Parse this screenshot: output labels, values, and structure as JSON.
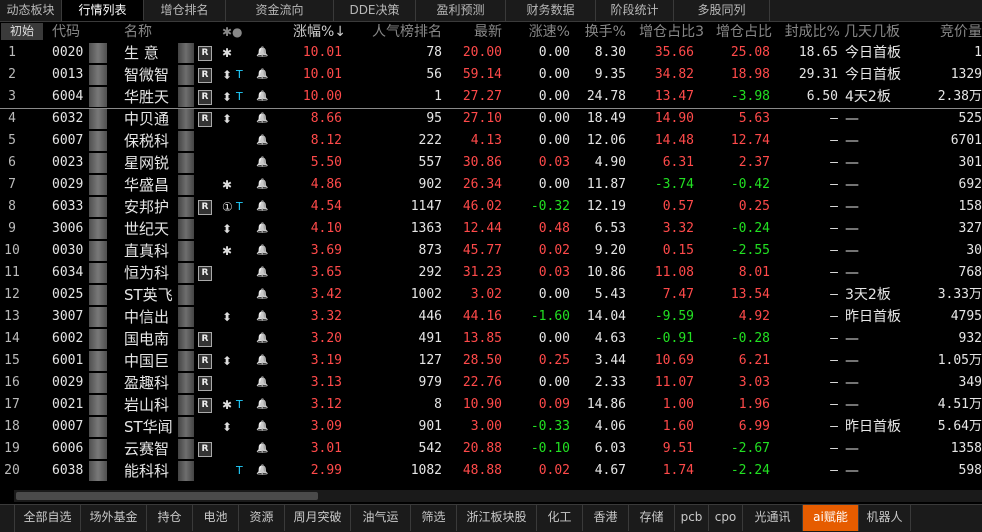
{
  "top_tabs": [
    "动态板块",
    "行情列表",
    "增仓排名",
    "资金流向",
    "DDE决策",
    "盈利预测",
    "财务数据",
    "阶段统计",
    "多股同列"
  ],
  "active_top_tab": 1,
  "header": {
    "init_label": "初始",
    "code": "代码",
    "name": "名称",
    "flags": "✱●",
    "change_pct": "涨幅%↓",
    "popularity": "人气榜排名",
    "latest": "最新",
    "speed": "涨速%",
    "turnover": "换手%",
    "add_pos1": "增仓占比3",
    "add_pos2": "增仓占比",
    "seal_ratio": "封成比%",
    "board_days": "几天几板",
    "auction": "竞价量"
  },
  "rows": [
    {
      "idx": "1",
      "code": "0020",
      "name": "生 意 ",
      "r": true,
      "f1": "✱",
      "t": false,
      "chg": "10.01",
      "chg_c": "red",
      "pop": "78",
      "last": "20.00",
      "last_c": "red",
      "spd": "0.00",
      "spd_c": "white",
      "turn": "8.30",
      "a1": "35.66",
      "a1_c": "red",
      "a2": "25.08",
      "a2_c": "red",
      "seal": "18.65",
      "board": "今日首板",
      "auc": "1"
    },
    {
      "idx": "2",
      "code": "0013",
      "name": "智微智",
      "r": true,
      "f1": "⬍",
      "t": true,
      "chg": "10.01",
      "chg_c": "red",
      "pop": "56",
      "last": "59.14",
      "last_c": "red",
      "spd": "0.00",
      "spd_c": "white",
      "turn": "9.35",
      "a1": "34.82",
      "a1_c": "red",
      "a2": "18.98",
      "a2_c": "red",
      "seal": "29.31",
      "board": "今日首板",
      "auc": "1329"
    },
    {
      "idx": "3",
      "code": "6004",
      "name": "华胜天",
      "r": true,
      "f1": "⬍",
      "t": true,
      "chg": "10.00",
      "chg_c": "red",
      "pop": "1",
      "last": "27.27",
      "last_c": "red",
      "spd": "0.00",
      "spd_c": "white",
      "turn": "24.78",
      "a1": "13.47",
      "a1_c": "red",
      "a2": "-3.98",
      "a2_c": "green",
      "seal": "6.50",
      "board": "4天2板",
      "auc": "2.38万"
    },
    {
      "idx": "4",
      "code": "6032",
      "name": "中贝通",
      "r": true,
      "f1": "⬍",
      "t": false,
      "chg": "8.66",
      "chg_c": "red",
      "pop": "95",
      "last": "27.10",
      "last_c": "red",
      "spd": "0.00",
      "spd_c": "white",
      "turn": "18.49",
      "a1": "14.90",
      "a1_c": "red",
      "a2": "5.63",
      "a2_c": "red",
      "seal": "—",
      "board": "—",
      "auc": "525"
    },
    {
      "idx": "5",
      "code": "6007",
      "name": "保税科",
      "r": false,
      "f1": "",
      "t": false,
      "chg": "8.12",
      "chg_c": "red",
      "pop": "222",
      "last": "4.13",
      "last_c": "red",
      "spd": "0.00",
      "spd_c": "white",
      "turn": "12.06",
      "a1": "14.48",
      "a1_c": "red",
      "a2": "12.74",
      "a2_c": "red",
      "seal": "—",
      "board": "—",
      "auc": "6701"
    },
    {
      "idx": "6",
      "code": "0023",
      "name": "星网锐",
      "r": false,
      "f1": "",
      "t": false,
      "chg": "5.50",
      "chg_c": "red",
      "pop": "557",
      "last": "30.86",
      "last_c": "red",
      "spd": "0.03",
      "spd_c": "red",
      "turn": "4.90",
      "a1": "6.31",
      "a1_c": "red",
      "a2": "2.37",
      "a2_c": "red",
      "seal": "—",
      "board": "—",
      "auc": "301"
    },
    {
      "idx": "7",
      "code": "0029",
      "name": "华盛昌",
      "r": false,
      "f1": "✱",
      "t": false,
      "chg": "4.86",
      "chg_c": "red",
      "pop": "902",
      "last": "26.34",
      "last_c": "red",
      "spd": "0.00",
      "spd_c": "white",
      "turn": "11.87",
      "a1": "-3.74",
      "a1_c": "green",
      "a2": "-0.42",
      "a2_c": "green",
      "seal": "—",
      "board": "—",
      "auc": "692"
    },
    {
      "idx": "8",
      "code": "6033",
      "name": "安邦护",
      "r": true,
      "f1": "①",
      "t": true,
      "chg": "4.54",
      "chg_c": "red",
      "pop": "1147",
      "last": "46.02",
      "last_c": "red",
      "spd": "-0.32",
      "spd_c": "green",
      "turn": "12.19",
      "a1": "0.57",
      "a1_c": "red",
      "a2": "0.25",
      "a2_c": "red",
      "seal": "—",
      "board": "—",
      "auc": "158"
    },
    {
      "idx": "9",
      "code": "3006",
      "name": "世纪天",
      "r": false,
      "f1": "⬍",
      "t": false,
      "chg": "4.10",
      "chg_c": "red",
      "pop": "1363",
      "last": "12.44",
      "last_c": "red",
      "spd": "0.48",
      "spd_c": "red",
      "turn": "6.53",
      "a1": "3.32",
      "a1_c": "red",
      "a2": "-0.24",
      "a2_c": "green",
      "seal": "—",
      "board": "—",
      "auc": "327"
    },
    {
      "idx": "10",
      "code": "0030",
      "name": "直真科",
      "r": false,
      "f1": "✱",
      "t": false,
      "chg": "3.69",
      "chg_c": "red",
      "pop": "873",
      "last": "45.77",
      "last_c": "red",
      "spd": "0.02",
      "spd_c": "red",
      "turn": "9.20",
      "a1": "0.15",
      "a1_c": "red",
      "a2": "-2.55",
      "a2_c": "green",
      "seal": "—",
      "board": "—",
      "auc": "30"
    },
    {
      "idx": "11",
      "code": "6034",
      "name": "恒为科",
      "r": true,
      "f1": "",
      "t": false,
      "chg": "3.65",
      "chg_c": "red",
      "pop": "292",
      "last": "31.23",
      "last_c": "red",
      "spd": "0.03",
      "spd_c": "red",
      "turn": "10.86",
      "a1": "11.08",
      "a1_c": "red",
      "a2": "8.01",
      "a2_c": "red",
      "seal": "—",
      "board": "—",
      "auc": "768"
    },
    {
      "idx": "12",
      "code": "0025",
      "name": "ST英飞",
      "r": false,
      "f1": "",
      "t": false,
      "chg": "3.42",
      "chg_c": "red",
      "pop": "1002",
      "last": "3.02",
      "last_c": "red",
      "spd": "0.00",
      "spd_c": "white",
      "turn": "5.43",
      "a1": "7.47",
      "a1_c": "red",
      "a2": "13.54",
      "a2_c": "red",
      "seal": "—",
      "board": "3天2板",
      "auc": "3.33万"
    },
    {
      "idx": "13",
      "code": "3007",
      "name": "中信出",
      "r": false,
      "f1": "⬍",
      "t": false,
      "chg": "3.32",
      "chg_c": "red",
      "pop": "446",
      "last": "44.16",
      "last_c": "red",
      "spd": "-1.60",
      "spd_c": "green",
      "turn": "14.04",
      "a1": "-9.59",
      "a1_c": "green",
      "a2": "4.92",
      "a2_c": "red",
      "seal": "—",
      "board": "昨日首板",
      "auc": "4795"
    },
    {
      "idx": "14",
      "code": "6002",
      "name": "国电南",
      "r": true,
      "f1": "",
      "t": false,
      "chg": "3.20",
      "chg_c": "red",
      "pop": "491",
      "last": "13.85",
      "last_c": "red",
      "spd": "0.00",
      "spd_c": "white",
      "turn": "4.63",
      "a1": "-0.91",
      "a1_c": "green",
      "a2": "-0.28",
      "a2_c": "green",
      "seal": "—",
      "board": "—",
      "auc": "932"
    },
    {
      "idx": "15",
      "code": "6001",
      "name": "中国巨",
      "r": true,
      "f1": "⬍",
      "t": false,
      "chg": "3.19",
      "chg_c": "red",
      "pop": "127",
      "last": "28.50",
      "last_c": "red",
      "spd": "0.25",
      "spd_c": "red",
      "turn": "3.44",
      "a1": "10.69",
      "a1_c": "red",
      "a2": "6.21",
      "a2_c": "red",
      "seal": "—",
      "board": "—",
      "auc": "1.05万"
    },
    {
      "idx": "16",
      "code": "0029",
      "name": "盈趣科",
      "r": true,
      "f1": "",
      "t": false,
      "chg": "3.13",
      "chg_c": "red",
      "pop": "979",
      "last": "22.76",
      "last_c": "red",
      "spd": "0.00",
      "spd_c": "white",
      "turn": "2.33",
      "a1": "11.07",
      "a1_c": "red",
      "a2": "3.03",
      "a2_c": "red",
      "seal": "—",
      "board": "—",
      "auc": "349"
    },
    {
      "idx": "17",
      "code": "0021",
      "name": "岩山科",
      "r": true,
      "f1": "✱",
      "t": true,
      "chg": "3.12",
      "chg_c": "red",
      "pop": "8",
      "last": "10.90",
      "last_c": "red",
      "spd": "0.09",
      "spd_c": "red",
      "turn": "14.86",
      "a1": "1.00",
      "a1_c": "red",
      "a2": "1.96",
      "a2_c": "red",
      "seal": "—",
      "board": "—",
      "auc": "4.51万"
    },
    {
      "idx": "18",
      "code": "0007",
      "name": "ST华闻",
      "r": false,
      "f1": "⬍",
      "t": false,
      "chg": "3.09",
      "chg_c": "red",
      "pop": "901",
      "last": "3.00",
      "last_c": "red",
      "spd": "-0.33",
      "spd_c": "green",
      "turn": "4.06",
      "a1": "1.60",
      "a1_c": "red",
      "a2": "6.99",
      "a2_c": "red",
      "seal": "—",
      "board": "昨日首板",
      "auc": "5.64万"
    },
    {
      "idx": "19",
      "code": "6006",
      "name": "云赛智",
      "r": true,
      "f1": "",
      "t": false,
      "chg": "3.01",
      "chg_c": "red",
      "pop": "542",
      "last": "20.88",
      "last_c": "red",
      "spd": "-0.10",
      "spd_c": "green",
      "turn": "6.03",
      "a1": "9.51",
      "a1_c": "red",
      "a2": "-2.67",
      "a2_c": "green",
      "seal": "—",
      "board": "—",
      "auc": "1358"
    },
    {
      "idx": "20",
      "code": "6038",
      "name": "能科科",
      "r": false,
      "f1": "",
      "t": true,
      "chg": "2.99",
      "chg_c": "red",
      "pop": "1082",
      "last": "48.88",
      "last_c": "red",
      "spd": "0.02",
      "spd_c": "red",
      "turn": "4.67",
      "a1": "1.74",
      "a1_c": "red",
      "a2": "-2.24",
      "a2_c": "green",
      "seal": "—",
      "board": "—",
      "auc": "598"
    }
  ],
  "bottom_tabs": [
    "全部自选",
    "场外基金",
    "持仓",
    "电池",
    "资源",
    "周月突破",
    "油气运",
    "筛选",
    "浙江板块股",
    "化工",
    "香港",
    "存储",
    "pcb",
    "cpo",
    "光通讯",
    "ai赋能",
    "机器人"
  ],
  "active_bottom_tab": 15,
  "colors": {
    "up": "#ff4a4a",
    "down": "#22e022",
    "flat": "#e6e6e6",
    "active_tab": "#e65c00"
  }
}
